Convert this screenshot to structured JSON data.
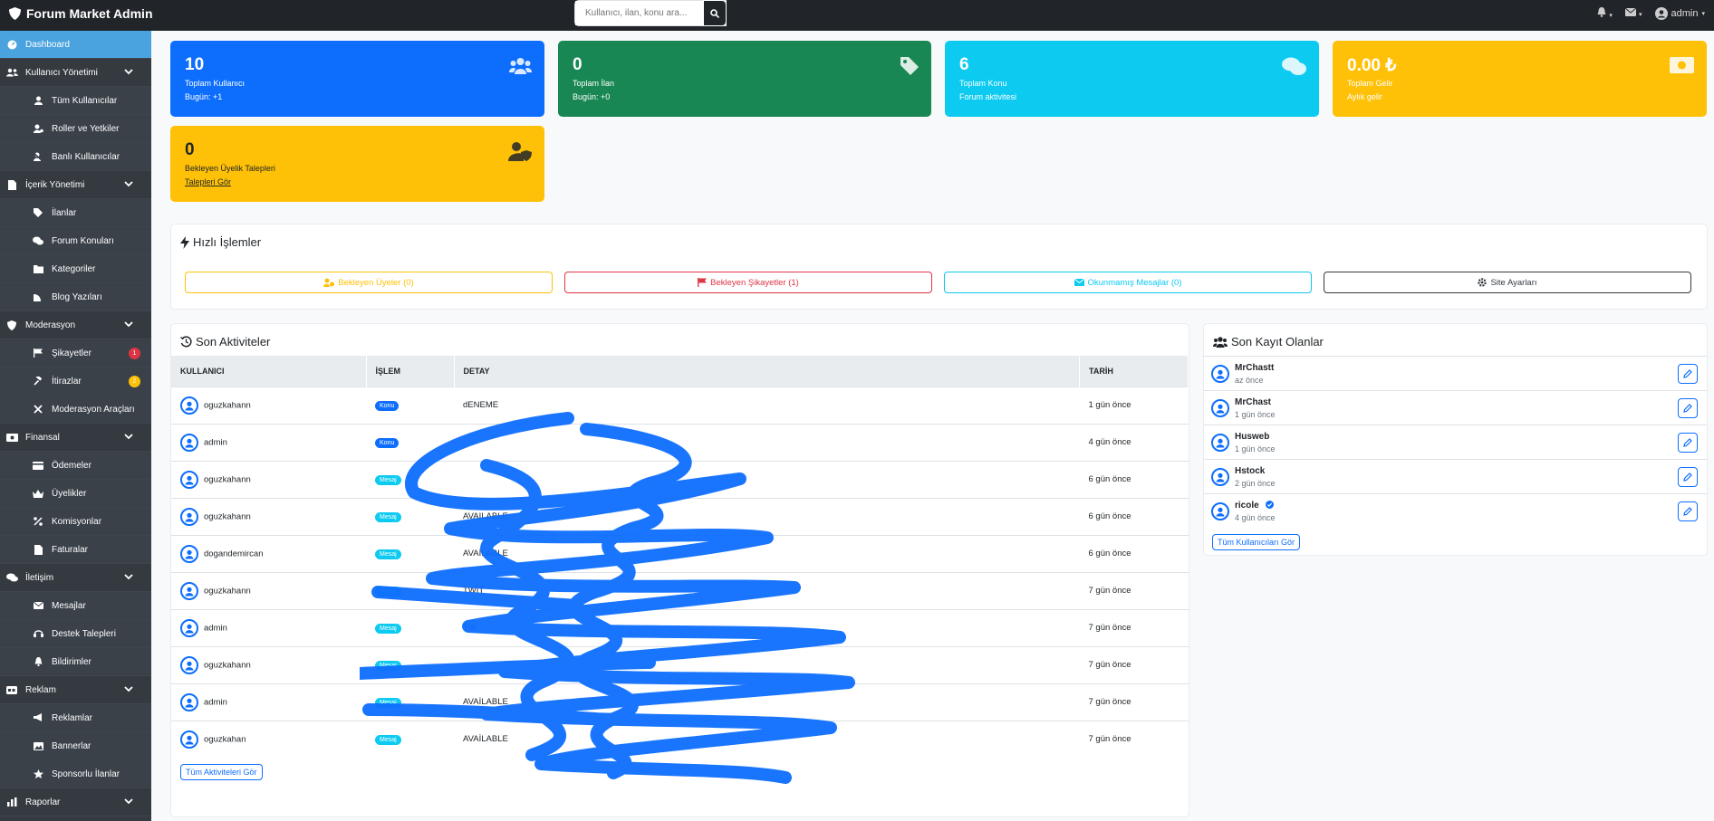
{
  "brand": "Forum Market Admin",
  "search": {
    "placeholder": "Kullanıcı, ilan, konu ara..."
  },
  "top_right": {
    "user": "admin"
  },
  "sidebar": {
    "dashboard": "Dashboard",
    "sections": [
      {
        "label": "Kullanıcı Yönetimi",
        "items": [
          "Tüm Kullanıcılar",
          "Roller ve Yetkiler",
          "Banlı Kullanıcılar"
        ]
      },
      {
        "label": "İçerik Yönetimi",
        "items": [
          "İlanlar",
          "Forum Konuları",
          "Kategoriler",
          "Blog Yazıları"
        ]
      },
      {
        "label": "Moderasyon",
        "items": [
          "Şikayetler",
          "İtirazlar",
          "Moderasyon Araçları"
        ]
      },
      {
        "label": "Finansal",
        "items": [
          "Ödemeler",
          "Üyelikler",
          "Komisyonlar",
          "Faturalar"
        ]
      },
      {
        "label": "İletişim",
        "items": [
          "Mesajlar",
          "Destek Talepleri",
          "Bildirimler"
        ]
      },
      {
        "label": "Reklam",
        "items": [
          "Reklamlar",
          "Bannerlar",
          "Sponsorlu İlanlar"
        ]
      },
      {
        "label": "Raporlar",
        "items": []
      }
    ],
    "badges": {
      "sikayetler": "1",
      "itirazlar": "2"
    }
  },
  "stats": [
    {
      "value": "10",
      "label": "Toplam Kullanıcı",
      "sub": "Bugün: +1",
      "color": "#0d6efd"
    },
    {
      "value": "0",
      "label": "Toplam İlan",
      "sub": "Bugün: +0",
      "color": "#198754"
    },
    {
      "value": "6",
      "label": "Toplam Konu",
      "sub": "Forum aktivitesi",
      "color": "#0dcaf0"
    },
    {
      "value": "0.00 ₺",
      "label": "Toplam Gelir",
      "sub": "Aylık gelir",
      "color": "#ffc107"
    },
    {
      "value": "0",
      "label": "Bekleyen Üyelik Talepleri",
      "sub": "Talepleri Gör",
      "color": "#ffc107"
    }
  ],
  "quick": {
    "title": "Hızlı İşlemler",
    "buttons": [
      "Bekleyen Üyeler (0)",
      "Bekleyen Şikayetler (1)",
      "Okunmamış Mesajlar (0)",
      "Site Ayarları"
    ]
  },
  "activities": {
    "title": "Son Aktiviteler",
    "headers": [
      "KULLANICI",
      "İŞLEM",
      "DETAY",
      "TARİH"
    ],
    "rows": [
      {
        "user": "oguzkahann",
        "action": "Konu",
        "detail": "dENEME",
        "date": "1 gün önce"
      },
      {
        "user": "admin",
        "action": "Konu",
        "detail": "",
        "date": "4 gün önce"
      },
      {
        "user": "oguzkahann",
        "action": "Mesaj",
        "detail": "",
        "date": "6 gün önce"
      },
      {
        "user": "oguzkahann",
        "action": "Mesaj",
        "detail": "AVAILABLE",
        "date": "6 gün önce"
      },
      {
        "user": "dogandemircan",
        "action": "Mesaj",
        "detail": "AVAİLABLE",
        "date": "6 gün önce"
      },
      {
        "user": "oguzkahann",
        "action": "Mesaj",
        "detail": "TWİT",
        "date": "7 gün önce"
      },
      {
        "user": "admin",
        "action": "Mesaj",
        "detail": "TW",
        "date": "7 gün önce"
      },
      {
        "user": "oguzkahann",
        "action": "Mesaj",
        "detail": "",
        "date": "7 gün önce"
      },
      {
        "user": "admin",
        "action": "Mesaj",
        "detail": "AVAİLABLE",
        "date": "7 gün önce"
      },
      {
        "user": "oguzkahan",
        "action": "Mesaj",
        "detail": "AVAİLABLE",
        "date": "7 gün önce"
      }
    ],
    "view_all": "Tüm Aktiviteleri Gör"
  },
  "recent_users": {
    "title": "Son Kayıt Olanlar",
    "rows": [
      {
        "name": "MrChastt",
        "time": "az önce"
      },
      {
        "name": "MrChast",
        "time": "1 gün önce"
      },
      {
        "name": "Husweb",
        "time": "1 gün önce"
      },
      {
        "name": "Hstock",
        "time": "2 gün önce"
      },
      {
        "name": "ricole",
        "time": "4 gün önce"
      }
    ],
    "view_all": "Tüm Kullanıcıları Gör"
  }
}
